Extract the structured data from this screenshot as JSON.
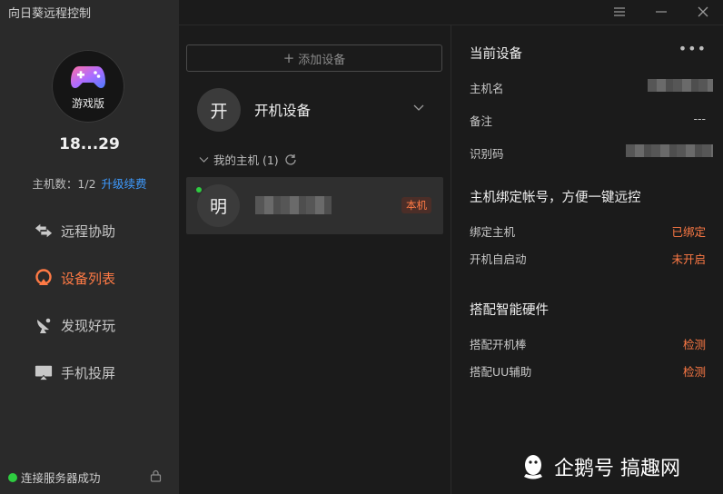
{
  "app": {
    "title": "向日葵远程控制"
  },
  "profile": {
    "edition": "游戏版",
    "user_id": "18...29",
    "host_count": "主机数：1/2",
    "upgrade": "升级续费"
  },
  "nav": [
    {
      "label": "远程协助"
    },
    {
      "label": "设备列表"
    },
    {
      "label": "发现好玩"
    },
    {
      "label": "手机投屏"
    }
  ],
  "status": {
    "text": "连接服务器成功",
    "color": "#2ecc40"
  },
  "devices": {
    "add_label": "添加设备",
    "boot_avatar": "开",
    "boot_label": "开机设备",
    "group_label": "我的主机 (1)",
    "item": {
      "avatar": "明",
      "badge": "本机"
    }
  },
  "current": {
    "title": "当前设备",
    "rows": [
      {
        "label": "主机名"
      },
      {
        "label": "备注",
        "value": "---"
      },
      {
        "label": "识别码"
      }
    ]
  },
  "bind": {
    "title": "主机绑定帐号，方便一键远控",
    "rows": [
      {
        "label": "绑定主机",
        "value": "已绑定"
      },
      {
        "label": "开机自启动",
        "value": "未开启"
      }
    ]
  },
  "hardware": {
    "title": "搭配智能硬件",
    "rows": [
      {
        "label": "搭配开机棒",
        "value": "检测"
      },
      {
        "label": "搭配UU辅助",
        "value": "检测"
      }
    ]
  },
  "watermark": {
    "text": "企鹅号 搞趣网"
  },
  "colors": {
    "accent": "#ff7a45",
    "link": "#3e9bff"
  }
}
